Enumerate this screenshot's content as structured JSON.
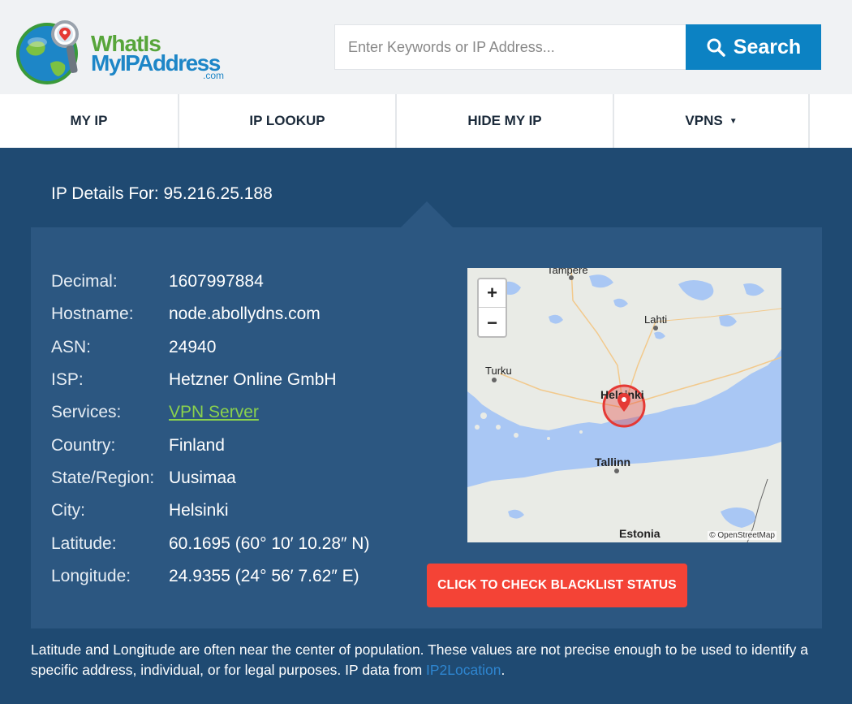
{
  "logo": {
    "line1": "WhatIs",
    "line2": "MyIPAddress",
    "line3": ".com",
    "icon": "globe-magnifier-icon"
  },
  "search": {
    "placeholder": "Enter Keywords or IP Address...",
    "value": "",
    "button_label": "Search",
    "button_icon": "search-icon"
  },
  "nav": {
    "items": [
      {
        "label": "MY IP"
      },
      {
        "label": "IP LOOKUP"
      },
      {
        "label": "HIDE MY IP"
      },
      {
        "label": "VPNS",
        "caret": "▼"
      }
    ]
  },
  "details": {
    "title": "IP Details For: 95.216.25.188",
    "rows": [
      {
        "label": "Decimal:",
        "value": "1607997884"
      },
      {
        "label": "Hostname:",
        "value": "node.abollydns.com"
      },
      {
        "label": "ASN:",
        "value": "24940"
      },
      {
        "label": "ISP:",
        "value": "Hetzner Online GmbH"
      },
      {
        "label": "Services:",
        "value": "VPN Server"
      },
      {
        "label": "Country:",
        "value": "Finland"
      },
      {
        "label": "State/Region:",
        "value": "Uusimaa"
      },
      {
        "label": "City:",
        "value": "Helsinki"
      },
      {
        "label": "Latitude:",
        "value": "60.1695 (60° 10′ 10.28″ N)"
      },
      {
        "label": "Longitude:",
        "value": "24.9355 (24° 56′ 7.62″ E)"
      }
    ]
  },
  "map": {
    "labels": {
      "tampere": "Tampere",
      "lahti": "Lahti",
      "turku": "Turku",
      "helsinki": "Helsinki",
      "tallinn": "Tallinn",
      "estonia": "Estonia"
    },
    "zoom_in": "+",
    "zoom_out": "−",
    "attribution": "© OpenStreetMap",
    "pin_icon": "map-pin-icon"
  },
  "blacklist_button": "CLICK TO CHECK BLACKLIST STATUS",
  "disclaimer": {
    "text": "Latitude and Longitude are often near the center of population. These values are not precise enough to be used to identify a specific address, individual, or for legal purposes. IP data from ",
    "link": "IP2Location",
    "end": "."
  },
  "colors": {
    "header_bg": "#f0f2f4",
    "main_bg": "#1f4a72",
    "card_bg": "#2c5781",
    "search_button": "#0c82c3",
    "blacklist_button": "#f44336",
    "link_green": "#8ad14d",
    "link_blue": "#2e86d1"
  }
}
